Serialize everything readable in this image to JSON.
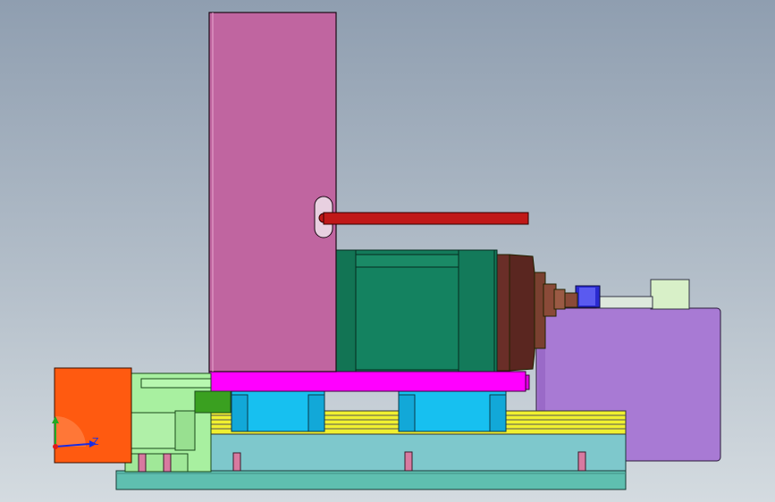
{
  "viewport": {
    "background_top": "#8f9eb0",
    "background_bottom": "#d4dbe0"
  },
  "triad": {
    "z_label": "Z",
    "x_axis_color": "#1a2be0",
    "y_axis_color": "#22aa22",
    "z_axis_color": "#e01a1a"
  },
  "model": {
    "colors": {
      "panel": "#c065a0",
      "rod": "#c01818",
      "motor": "#137a5a",
      "motor_flange": "#6a2e28",
      "cover": "#a87ad4",
      "pink_plate": "#ff00ff",
      "blocks": "#17c0f0",
      "yellow_rails": "#f0f030",
      "base": "#7ec8cc",
      "floor_plate": "#5fbfb0",
      "left_block": "#ff5a10",
      "green_shaft": "#a8f0a0",
      "coupler": "#2a2ad0",
      "pins": "#d87aa0"
    }
  }
}
